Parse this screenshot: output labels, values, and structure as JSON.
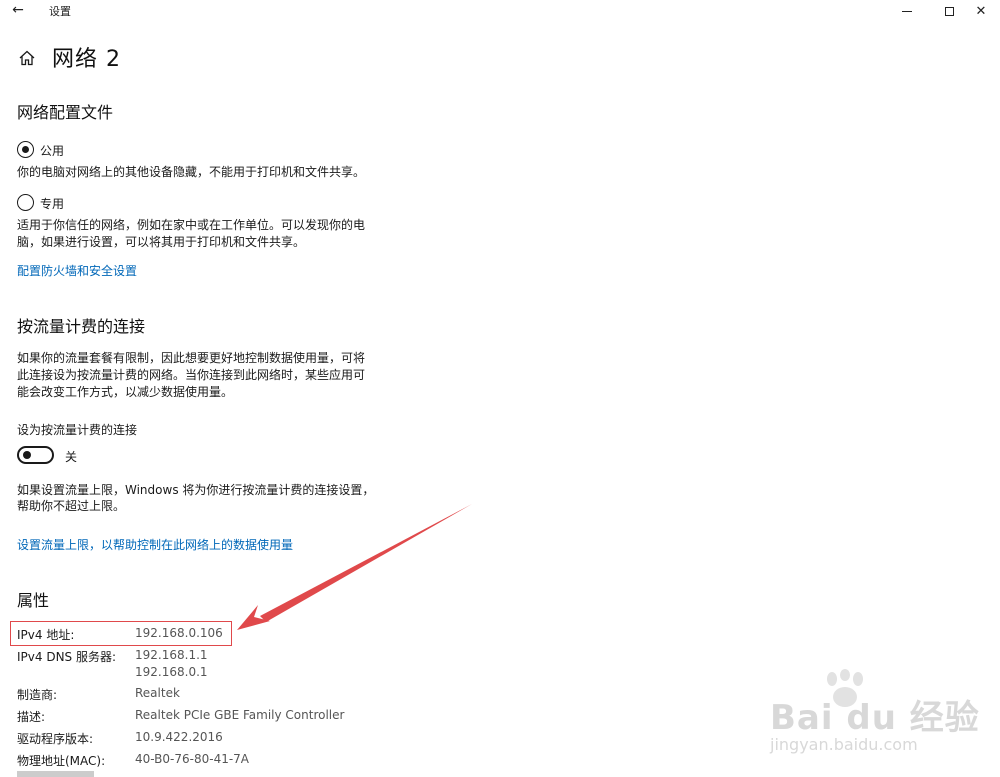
{
  "window": {
    "back_glyph": "←",
    "title": "设置",
    "minimize": "minimize",
    "maximize": "maximize",
    "close_glyph": "✕"
  },
  "page": {
    "title": "网络 2"
  },
  "profile": {
    "heading": "网络配置文件",
    "public_label": "公用",
    "public_desc": "你的电脑对网络上的其他设备隐藏，不能用于打印机和文件共享。",
    "private_label": "专用",
    "private_desc_line1": "适用于你信任的网络，例如在家中或在工作单位。可以发现你的电",
    "private_desc_line2": "脑，如果进行设置，可以将其用于打印机和文件共享。",
    "selected": "public",
    "firewall_link": "配置防火墙和安全设置"
  },
  "metered": {
    "heading": "按流量计费的连接",
    "desc_line1": "如果你的流量套餐有限制，因此想要更好地控制数据使用量，可将",
    "desc_line2": "此连接设为按流量计费的网络。当你连接到此网络时，某些应用可",
    "desc_line3": "能会改变工作方式，以减少数据使用量。",
    "toggle_label": "设为按流量计费的连接",
    "toggle_state": "关",
    "toggle_on": false,
    "limit_desc_line1": "如果设置流量上限，Windows 将为你进行按流量计费的连接设置，",
    "limit_desc_line2": "帮助你不超过上限。",
    "limit_link": "设置流量上限，以帮助控制在此网络上的数据使用量"
  },
  "properties": {
    "heading": "属性",
    "rows": [
      {
        "key": "IPv4 地址:",
        "value": "192.168.0.106"
      },
      {
        "key": "IPv4 DNS 服务器:",
        "value": "192.168.1.1",
        "value2": "192.168.0.1"
      },
      {
        "key": "制造商:",
        "value": "Realtek"
      },
      {
        "key": "描述:",
        "value": "Realtek PCIe GBE Family Controller"
      },
      {
        "key": "驱动程序版本:",
        "value": "10.9.422.2016"
      },
      {
        "key": "物理地址(MAC):",
        "value": "40-B0-76-80-41-7A"
      }
    ]
  },
  "annotation": {
    "color": "#e0494b"
  },
  "watermark": {
    "logo": "Bai du 经验",
    "url": "jingyan.baidu.com"
  }
}
